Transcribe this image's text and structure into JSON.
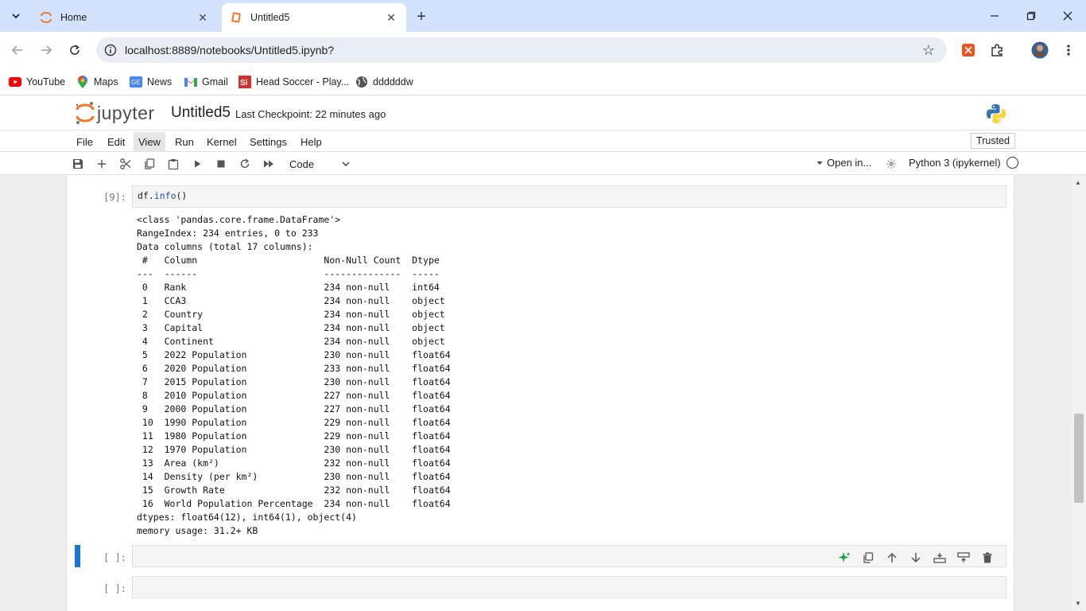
{
  "browser": {
    "tabs": [
      {
        "title": "Home",
        "active": false
      },
      {
        "title": "Untitled5",
        "active": true
      }
    ],
    "url": "localhost:8889/notebooks/Untitled5.ipynb?",
    "bookmarks": [
      {
        "label": "YouTube",
        "icon": "youtube-icon"
      },
      {
        "label": "Maps",
        "icon": "maps-icon"
      },
      {
        "label": "News",
        "icon": "news-icon"
      },
      {
        "label": "Gmail",
        "icon": "gmail-icon"
      },
      {
        "label": "Head Soccer - Play...",
        "icon": "head-soccer-icon"
      },
      {
        "label": "ddddddw",
        "icon": "globe-icon"
      }
    ]
  },
  "jupyter": {
    "logo_text": "jupyter",
    "notebook_name": "Untitled5",
    "checkpoint": "Last Checkpoint: 22 minutes ago",
    "menus": [
      "File",
      "Edit",
      "View",
      "Run",
      "Kernel",
      "Settings",
      "Help"
    ],
    "active_menu": "View",
    "trusted": "Trusted",
    "cell_type": "Code",
    "open_in": "Open in...",
    "kernel": "Python 3 (ipykernel)"
  },
  "cells": [
    {
      "prompt": "[9]:",
      "code_obj": "df",
      "code_dot": ".",
      "code_attr": "info",
      "code_paren": "()",
      "output": "<class 'pandas.core.frame.DataFrame'>\nRangeIndex: 234 entries, 0 to 233\nData columns (total 17 columns):\n #   Column                       Non-Null Count  Dtype  \n---  ------                       --------------  -----  \n 0   Rank                         234 non-null    int64  \n 1   CCA3                         234 non-null    object \n 2   Country                      234 non-null    object \n 3   Capital                      234 non-null    object \n 4   Continent                    234 non-null    object \n 5   2022 Population              230 non-null    float64\n 6   2020 Population              233 non-null    float64\n 7   2015 Population              230 non-null    float64\n 8   2010 Population              227 non-null    float64\n 9   2000 Population              227 non-null    float64\n 10  1990 Population              229 non-null    float64\n 11  1980 Population              229 non-null    float64\n 12  1970 Population              230 non-null    float64\n 13  Area (km²)                   232 non-null    float64\n 14  Density (per km²)            230 non-null    float64\n 15  Growth Rate                  232 non-null    float64\n 16  World Population Percentage  234 non-null    float64\ndtypes: float64(12), int64(1), object(4)\nmemory usage: 31.2+ KB"
    },
    {
      "prompt": "[ ]:"
    },
    {
      "prompt": "[ ]:"
    }
  ]
}
